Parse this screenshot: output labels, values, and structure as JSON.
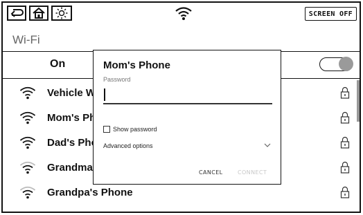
{
  "status_bar": {
    "back_icon": "back-arrow-icon",
    "home_icon": "home-icon",
    "brightness_icon": "brightness-icon",
    "wifi_icon": "wifi-icon",
    "screen_off_label": "SCREEN OFF"
  },
  "page": {
    "title": "Wi-Fi",
    "toggle_label": "On",
    "toggle_state": "on"
  },
  "networks": [
    {
      "name": "Vehicle Wi-Fi",
      "signal": 4,
      "locked": true
    },
    {
      "name": "Mom's Phone",
      "signal": 4,
      "locked": true
    },
    {
      "name": "Dad's Phone",
      "signal": 4,
      "locked": true
    },
    {
      "name": "Grandma's Phone",
      "signal": 3,
      "locked": true
    },
    {
      "name": "Grandpa's Phone",
      "signal": 3,
      "locked": true
    }
  ],
  "dialog": {
    "title": "Mom's Phone",
    "password_label": "Password",
    "password_value": "",
    "show_password_label": "Show password",
    "show_password_checked": false,
    "advanced_label": "Advanced options",
    "cancel_label": "CANCEL",
    "connect_label": "CONNECT",
    "connect_enabled": false
  },
  "colors": {
    "text": "#111111",
    "muted": "#666666",
    "disabled": "#c8c8c8",
    "toggle_knob": "#9a9a9a"
  }
}
